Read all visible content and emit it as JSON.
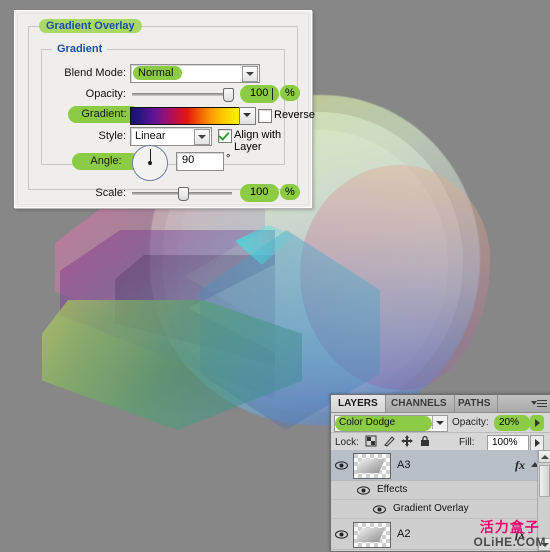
{
  "app": {
    "background_color": "#878787",
    "accent_highlight": "#8ccc44",
    "title_color": "#1b4fa8"
  },
  "dialog": {
    "group_title": "Gradient Overlay",
    "section_title": "Gradient",
    "blend_mode": {
      "label": "Blend Mode:",
      "value": "Normal"
    },
    "opacity": {
      "label": "Opacity:",
      "value": "100",
      "unit": "%",
      "slider_percent": 100
    },
    "gradient": {
      "label": "Gradient:",
      "reverse_label": "Reverse",
      "reverse_checked": false,
      "stops": [
        "#1b1170",
        "#5a1496",
        "#bd0f4a",
        "#e3160f",
        "#fb9a03",
        "#fdf200"
      ]
    },
    "style": {
      "label": "Style:",
      "value": "Linear",
      "align_label": "Align with Layer",
      "align_checked": true
    },
    "angle": {
      "label": "Angle:",
      "value": "90",
      "unit": "°",
      "degrees": 90
    },
    "scale": {
      "label": "Scale:",
      "value": "100",
      "unit": "%",
      "slider_percent": 50
    }
  },
  "layers_panel": {
    "tabs": [
      {
        "label": "LAYERS",
        "active": true
      },
      {
        "label": "CHANNELS",
        "active": false
      },
      {
        "label": "PATHS",
        "active": false
      }
    ],
    "menu_icon": "panel-menu-icon",
    "blend_mode": "Color Dodge",
    "opacity_label": "Opacity:",
    "opacity_value": "20%",
    "lock_label": "Lock:",
    "lock_icons": [
      "lock-transparency-icon",
      "lock-paint-icon",
      "lock-position-icon",
      "lock-all-icon"
    ],
    "fill_label": "Fill:",
    "fill_value": "100%",
    "rows": [
      {
        "name": "A3",
        "fx_badge": "fx",
        "selected": true
      },
      {
        "name": "Effects",
        "kind": "effects-group"
      },
      {
        "name": "Gradient Overlay",
        "kind": "effect"
      },
      {
        "name": "A2",
        "fx_badge": "fx",
        "selected": false
      }
    ]
  },
  "watermark": {
    "chinese": "活力盒子",
    "english": "OLiHE.COM",
    "color": "#e4006b"
  }
}
